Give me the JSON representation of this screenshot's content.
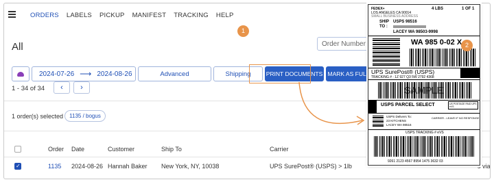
{
  "nav": {
    "items": [
      "ORDERS",
      "LABELS",
      "PICKUP",
      "MANIFEST",
      "TRACKING",
      "HELP"
    ],
    "active": "ORDERS"
  },
  "page": {
    "title": "All",
    "order_number_placeholder": "Order Number"
  },
  "callouts": {
    "one": "1",
    "two": "2"
  },
  "filters": {
    "date_from": "2024-07-26",
    "date_to": "2024-08-26",
    "advanced": "Advanced",
    "shipping": "Shipping",
    "print_documents": "PRINT DOCUMENTS",
    "mark_fulfilled": "MARK AS FULFILLED"
  },
  "pagination": {
    "range": "1 - 34 of 34",
    "prev": "‹",
    "next": "›"
  },
  "selection": {
    "text": "1 order(s) selected",
    "pill": "1135 / bogus"
  },
  "table": {
    "headers": [
      "Order",
      "Date",
      "Customer",
      "Ship To",
      "Carrier"
    ],
    "rows": [
      {
        "order": "1135",
        "date": "2024-08-26",
        "customer": "Hannah Baker",
        "ship_to": "New York, NY, 10038",
        "carrier": "UPS SurePost® (USPS) > 1lb",
        "extra": "s via"
      }
    ]
  },
  "label": {
    "fedex": "FEDEX+",
    "addr1": "LOS ANGELES CA 90014",
    "addr2": "SMALL BUSINESS ADDRESS",
    "weight": "4 LBS",
    "page": "1 OF 1",
    "ship": "SHIP",
    "ship_carrier": "USPS 98516",
    "to": "TO :",
    "to_line": "LACEY  WA  98503-9998",
    "route": "WA 985 0-02 X",
    "service": "UPS SurePost® (USPS)",
    "tracking": "TRACKING # : 1Z 927 Q3 5W 2792 4368",
    "sample": "SAMPLE",
    "parcel": "USPS PARCEL SELECT",
    "postage": "US POSTAGE PAID UPS eVS",
    "delivery_name": "USPS Delivers To:",
    "delivery_street": "23 KITCHENS",
    "delivery_city": "LACEY WA 98516",
    "carrier_leave": "CARRIER - LEAVE IF NO RESPONSE",
    "usps_tracking": "USPS TRACKING # eVS",
    "usps_number": "9261 2123 4567 8954 1475 3632 03"
  },
  "colors": {
    "accent": "#1f4fb5",
    "button": "#2a5fc4",
    "callout": "#e8944a"
  }
}
